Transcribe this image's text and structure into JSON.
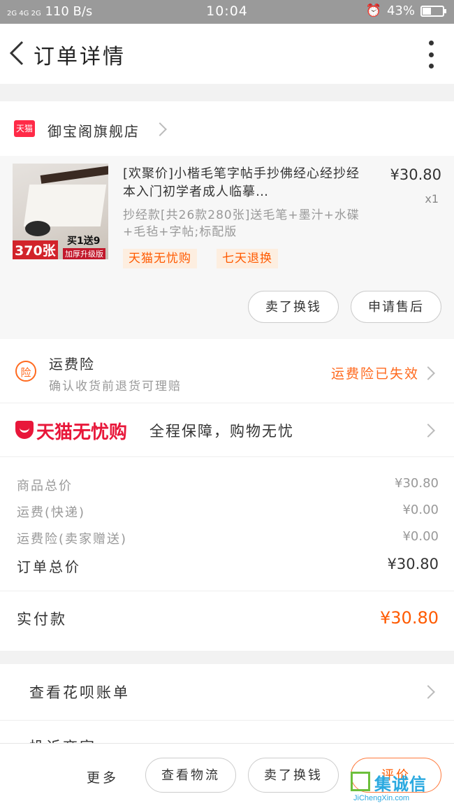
{
  "status_bar": {
    "network_left": "2G 4G 2G",
    "speed": "110 B/s",
    "time": "10:04",
    "battery": "43%",
    "battery_level": 0.43
  },
  "nav": {
    "title": "订单详情"
  },
  "shop": {
    "badge": "天猫",
    "name": "御宝阁旗舰店"
  },
  "product": {
    "title": "[欢聚价]小楷毛笔字帖手抄佛经心经抄经本入门初学者成人临摹…",
    "price": "¥30.80",
    "qty": "x1",
    "sku": "抄经款[共26款280张]送毛笔+墨汁+水碟+毛毡+字帖;标配版",
    "tags": [
      "天猫无忧购",
      "七天退换"
    ],
    "thumb_tag_count": "370张",
    "thumb_tag_promo": "买1送9",
    "thumb_tag_edition": "加厚升级版",
    "buttons": [
      "卖了换钱",
      "申请售后"
    ]
  },
  "insurance": {
    "icon": "险",
    "title": "运费险",
    "subtitle": "确认收货前退货可理赔",
    "status": "运费险已失效"
  },
  "wuyou": {
    "logo": "天猫无忧购",
    "desc": "全程保障，购物无忧"
  },
  "summary": {
    "rows": [
      {
        "label": "商品总价",
        "value": "¥30.80"
      },
      {
        "label": "运费(快递)",
        "value": "¥0.00"
      },
      {
        "label": "运费险(卖家赠送)",
        "value": "¥0.00"
      }
    ],
    "total_label": "订单总价",
    "total_value": "¥30.80"
  },
  "paid": {
    "label": "实付款",
    "value": "¥30.80"
  },
  "links": {
    "huabei": "查看花呗账单",
    "partial": "投诉商家"
  },
  "bottom_bar": {
    "more": "更多",
    "buttons": [
      "查看物流",
      "卖了换钱",
      "评价"
    ]
  },
  "watermark": {
    "text": "集诚信",
    "url": "JiChengXin.com"
  },
  "colors": {
    "accent": "#ff5a00",
    "tmall_red": "#e8173a",
    "status_bar": "#9a9a9a"
  }
}
